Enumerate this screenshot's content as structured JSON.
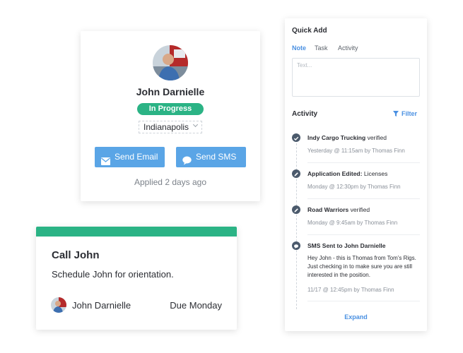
{
  "colors": {
    "status_green": "#2bb385",
    "button_blue": "#5aa5e6",
    "link_blue": "#4a90e2",
    "timeline_dot": "#4b5a6c"
  },
  "profile": {
    "name": "John Darnielle",
    "status": "In Progress",
    "location": "Indianapolis",
    "send_email": "Send Email",
    "send_sms": "Send SMS",
    "applied": "Applied 2 days ago"
  },
  "task": {
    "title": "Call John",
    "description": "Schedule John for orientation.",
    "contact": "John Darnielle",
    "due": "Due Monday"
  },
  "quick_add": {
    "title": "Quick Add",
    "tabs": [
      "Note",
      "Task",
      "Activity"
    ],
    "active_tab": "Note",
    "placeholder": "Text..."
  },
  "activity": {
    "title": "Activity",
    "filter": "Filter",
    "expand": "Expand",
    "items": [
      {
        "icon": "check-icon",
        "subject": "Indy Cargo Trucking",
        "action": "verified",
        "meta": "Yesterday @ 11:15am by Thomas Finn"
      },
      {
        "icon": "pencil-icon",
        "subject": "Application Edited:",
        "action": "Licenses",
        "meta": "Monday @ 12:30pm by Thomas Finn"
      },
      {
        "icon": "pencil-icon",
        "subject": "Road Warriors",
        "action": "verified",
        "meta": "Monday @ 9:45am by Thomas Finn"
      },
      {
        "icon": "chat-bubble-icon",
        "subject": "SMS Sent to John Darnielle",
        "action": "",
        "body": "Hey John - this is Thomas from Tom’s Rigs. Just checking in to make sure you are still interested in the position.",
        "meta": "11/17 @ 12:45pm by Thomas Finn"
      }
    ]
  }
}
